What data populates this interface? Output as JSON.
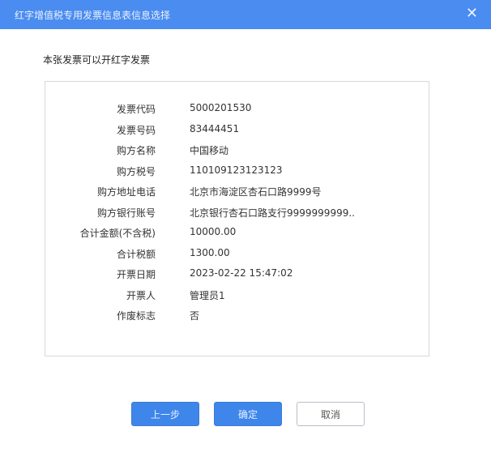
{
  "dialog": {
    "title": "红字增值税专用发票信息表信息选择",
    "close_icon": "close-icon"
  },
  "notice": "本张发票可以开红字发票",
  "fields": [
    {
      "label": "发票代码",
      "value": "5000201530"
    },
    {
      "label": "发票号码",
      "value": "83444451"
    },
    {
      "label": "购方名称",
      "value": "中国移动"
    },
    {
      "label": "购方税号",
      "value": "110109123123123"
    },
    {
      "label": "购方地址电话",
      "value": "北京市海淀区杏石口路9999号"
    },
    {
      "label": "购方银行账号",
      "value": "北京银行杏石口路支行9999999999.."
    },
    {
      "label": "合计金额(不含税)",
      "value": "10000.00"
    },
    {
      "label": "合计税额",
      "value": "1300.00"
    },
    {
      "label": "开票日期",
      "value": "2023-02-22 15:47:02"
    },
    {
      "label": "开票人",
      "value": "管理员1"
    },
    {
      "label": "作废标志",
      "value": "否"
    }
  ],
  "buttons": {
    "prev": "上一步",
    "ok": "确定",
    "cancel": "取消"
  }
}
